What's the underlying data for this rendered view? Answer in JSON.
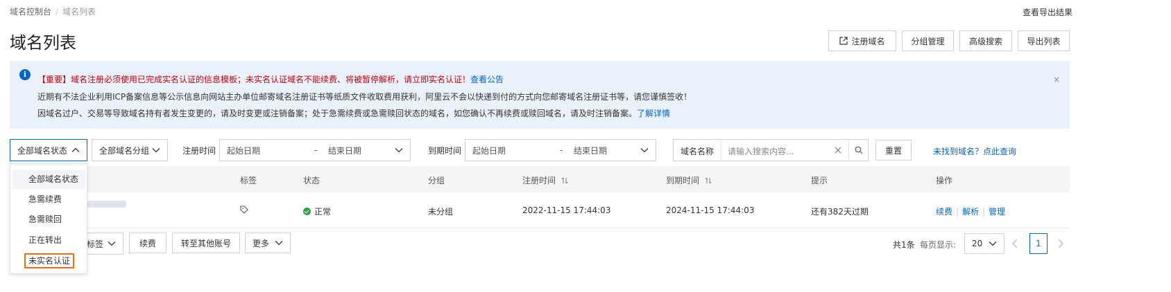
{
  "breadcrumb": {
    "root": "域名控制台",
    "current": "域名列表"
  },
  "header": {
    "export_results": "查看导出结果",
    "title": "域名列表",
    "buttons": {
      "register": "注册域名",
      "group_manage": "分组管理",
      "advanced_search": "高级搜索",
      "export_list": "导出列表"
    }
  },
  "notice": {
    "line1": "【重要】域名注册必须使用已完成实名认证的信息模板；未实名认证域名不能续费、将被暂停解析，请立即实名认证！",
    "line1_link": "查看公告",
    "line2": "近期有不法企业利用ICP备案信息等公示信息向网站主办单位邮寄域名注册证书等纸质文件收取费用获利，阿里云不会以快递到付的方式向您邮寄域名注册证书等，请您谨慎签收！",
    "line3": "因域名过户、交易等导致域名持有者发生变更的，请及时变更或注销备案；处于急需续费或急需赎回状态的域名，如您确认不再续费或赎回域名，请及时注销备案。",
    "line3_link": "了解详情",
    "close": "×"
  },
  "filters": {
    "status_select": "全部域名状态",
    "group_select": "全部域名分组",
    "reg_time_label": "注册时间",
    "exp_time_label": "到期时间",
    "start_date": "起始日期",
    "end_date": "结束日期",
    "date_sep": "-",
    "search_field": "域名名称",
    "search_placeholder": "请输入搜索内容...",
    "reset": "重置",
    "not_found_link": "未找到域名？点此查询"
  },
  "status_dropdown": [
    "全部域名状态",
    "急需续费",
    "急需赎回",
    "正在转出",
    "未实名认证"
  ],
  "table": {
    "headers": {
      "tag": "标签",
      "status": "状态",
      "group": "分组",
      "reg_time": "注册时间",
      "exp_time": "到期时间",
      "hint": "提示",
      "ops": "操作"
    },
    "rows": [
      {
        "status": "正常",
        "group": "未分组",
        "reg_time": "2022-11-15 17:44:03",
        "exp_time": "2024-11-15 17:44:03",
        "hint": "还有382天过期",
        "op_renew": "续费",
        "op_dns": "解析",
        "op_manage": "管理"
      }
    ]
  },
  "footer": {
    "tag_select": "标签",
    "renew": "续费",
    "transfer": "转至其他账号",
    "more": "更多",
    "total": "共1条",
    "per_page_label": "每页显示:",
    "per_page": "20",
    "current_page": "1"
  },
  "colors": {
    "accent": "#0064c8",
    "notice_bg": "#ebf1fa",
    "warning_red": "#c7000b",
    "success": "#2aa53e",
    "highlight_box": "#ef6d13"
  }
}
